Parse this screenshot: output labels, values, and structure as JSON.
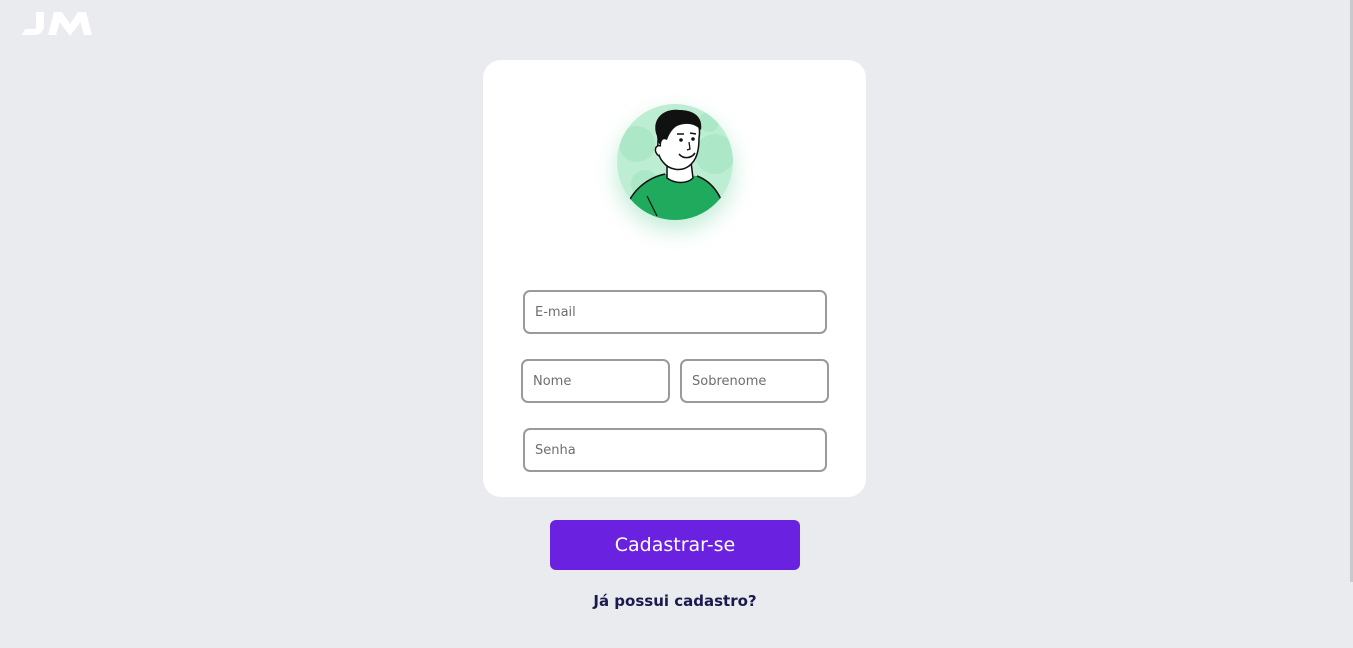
{
  "brand": {
    "logo_text": "JM"
  },
  "form": {
    "email_placeholder": "E-mail",
    "first_name_placeholder": "Nome",
    "last_name_placeholder": "Sobrenome",
    "password_placeholder": "Senha"
  },
  "actions": {
    "submit_label": "Cadastrar-se",
    "login_link": "Já possui cadastro?"
  },
  "colors": {
    "background": "#e9ebee",
    "card": "#ffffff",
    "primary": "#6a22e0",
    "link": "#1b1a4f",
    "avatar_bg": "#bdeed3",
    "shirt": "#1faa5e"
  },
  "icons": {
    "avatar": "user-avatar-illustration"
  }
}
